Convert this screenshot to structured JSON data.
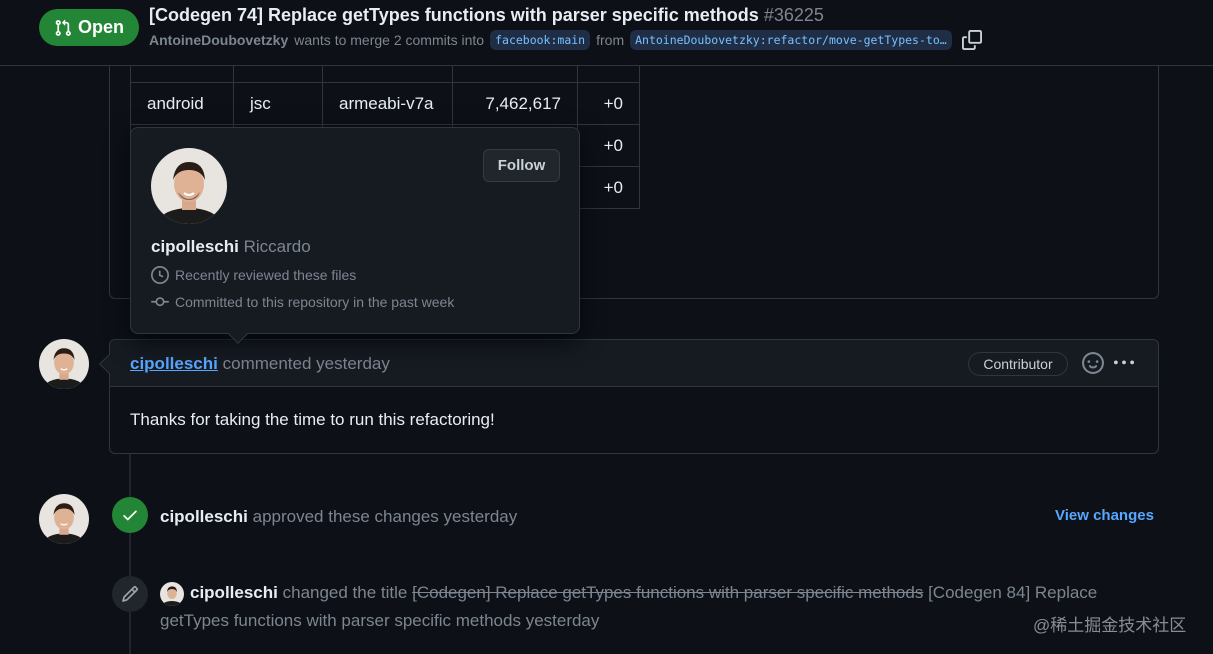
{
  "header": {
    "state": "Open",
    "title": "[Codegen 74] Replace getTypes functions with parser specific methods",
    "number": "#36225",
    "author": "AntoineDoubovetzky",
    "merge_text": "wants to merge 2 commits into",
    "base_branch": "facebook:main",
    "from_text": "from",
    "head_branch": "AntoineDoubovetzky:refactor/move-getTypes-to…"
  },
  "size_table": {
    "rows": [
      [
        "android",
        "jsc",
        "armeabi-v7a",
        "7,462,617",
        "+0"
      ],
      [
        "",
        "",
        "",
        "",
        "+0"
      ],
      [
        "",
        "",
        "",
        "",
        "+0"
      ]
    ]
  },
  "hovercard": {
    "follow_label": "Follow",
    "login": "cipolleschi",
    "name": "Riccardo",
    "reviewed_text": "Recently reviewed these files",
    "committed_text": "Committed to this repository in the past week"
  },
  "comment": {
    "author": "cipolleschi",
    "action": "commented yesterday",
    "badge": "Contributor",
    "body": "Thanks for taking the time to run this refactoring!"
  },
  "approval": {
    "author": "cipolleschi",
    "action": "approved these changes yesterday",
    "view_changes": "View changes"
  },
  "rename": {
    "author": "cipolleschi",
    "action": "changed the title",
    "old_title": "[Codegen] Replace getTypes functions with parser specific methods",
    "new_title_part1": "[Codegen 84] Replace",
    "new_title_part2": "getTypes functions with parser specific methods",
    "when": "yesterday"
  },
  "watermark": "@稀土掘金技术社区",
  "colors": {
    "background": "#0d1117",
    "open_green": "#238636",
    "link_blue": "#58a6ff",
    "muted": "#7d8590"
  }
}
